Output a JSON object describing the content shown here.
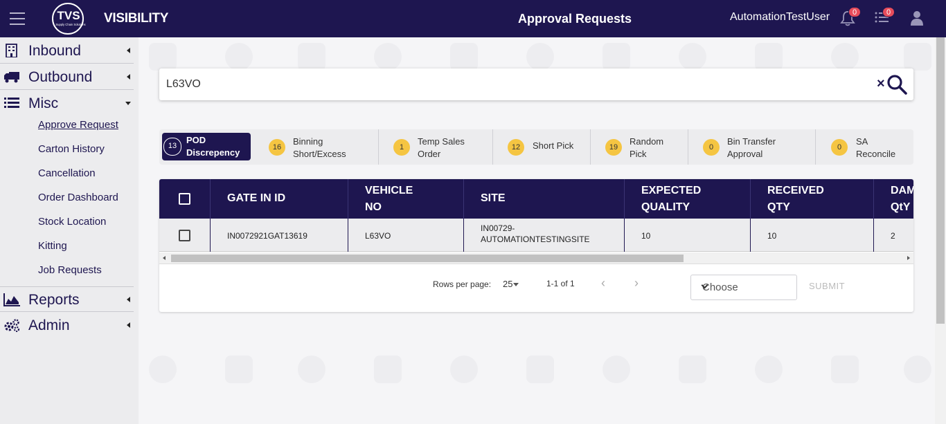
{
  "header": {
    "brand": "VISIBILITY",
    "logo_text": "TVS",
    "logo_subtext": "Supply Chain Solutions",
    "page_title": "Approval Requests",
    "username": "AutomationTestUser",
    "notifications_count": "0",
    "tasks_count": "0"
  },
  "sidebar": {
    "items": [
      {
        "label": "Inbound",
        "icon": "building-icon"
      },
      {
        "label": "Outbound",
        "icon": "truck-icon"
      },
      {
        "label": "Misc",
        "icon": "list-icon"
      },
      {
        "label": "Reports",
        "icon": "area-chart-icon"
      },
      {
        "label": "Admin",
        "icon": "gears-icon"
      }
    ],
    "misc_subitems": [
      "Approve Request",
      "Carton History",
      "Cancellation",
      "Order Dashboard",
      "Stock Location",
      "Kitting",
      "Job Requests"
    ]
  },
  "search": {
    "value": "L63VO",
    "clear_symbol": "×"
  },
  "tabs": [
    {
      "count": "13",
      "line1": "POD",
      "line2": "Discrepency",
      "active": true
    },
    {
      "count": "16",
      "line1": "Binning",
      "line2": "Short/Excess"
    },
    {
      "count": "1",
      "line1": "Temp Sales",
      "line2": "Order"
    },
    {
      "count": "12",
      "line1": "Short Pick",
      "line2": ""
    },
    {
      "count": "19",
      "line1": "Random",
      "line2": "Pick"
    },
    {
      "count": "0",
      "line1": "Bin Transfer",
      "line2": "Approval"
    },
    {
      "count": "0",
      "line1": "SA",
      "line2": "Reconcile"
    }
  ],
  "table": {
    "columns": [
      {
        "line1": "GATE IN ID",
        "line2": ""
      },
      {
        "line1": "VEHICLE",
        "line2": "NO"
      },
      {
        "line1": "SITE",
        "line2": ""
      },
      {
        "line1": "EXPECTED",
        "line2": "QUALITY"
      },
      {
        "line1": "RECEIVED",
        "line2": "QTY"
      },
      {
        "line1": "DAM",
        "line2": "QtY"
      }
    ],
    "rows": [
      {
        "gate_in_id": "IN0072921GAT13619",
        "vehicle_no": "L63VO",
        "site_line1": "IN00729-",
        "site_line2": "AUTOMATIONTESTINGSITE",
        "expected_quality": "10",
        "received_qty": "10",
        "damaged_qty": "2"
      }
    ]
  },
  "pagination": {
    "rows_per_page_label": "Rows per page:",
    "rows_per_page": "25",
    "range": "1-1 of 1"
  },
  "action": {
    "choose_placeholder": "Choose",
    "submit_label": "SUBMIT"
  },
  "colors": {
    "primary": "#1e1650",
    "badge": "#e74c5b",
    "tab_count": "#f5c542"
  }
}
